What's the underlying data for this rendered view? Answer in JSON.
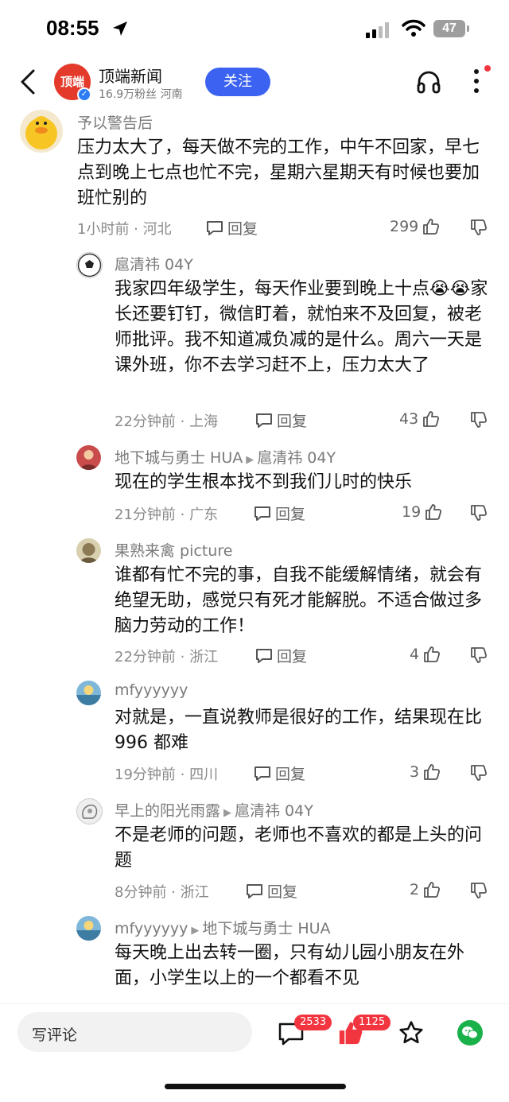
{
  "status_bar": {
    "time": "08:55",
    "battery": "47"
  },
  "header": {
    "account_name": "顶端新闻",
    "logo_text": "顶端",
    "account_meta": "16.9万粉丝 河南",
    "follow_label": "关注"
  },
  "comments": [
    {
      "user": "予以警告后",
      "text": "压力太大了，每天做不完的工作，中午不回家，早七点到晚上七点也忙不完，星期六星期天有时候也要加班忙别的",
      "meta": "1小时前 · 河北",
      "reply_label": "回复",
      "likes": "299"
    },
    {
      "user": "扈清祎 04Y",
      "text": "我家四年级学生，每天作业要到晚上十点😭😭家长还要钉钉，微信盯着，就怕来不及回复，被老师批评。我不知道减负减的是什么。周六一天是课外班，你不去学习赶不上，压力太大了",
      "meta": "22分钟前 · 上海",
      "reply_label": "回复",
      "likes": "43"
    },
    {
      "user": "地下城与勇士 HUA",
      "reply_to": "扈清祎 04Y",
      "text": "现在的学生根本找不到我们儿时的快乐",
      "meta": "21分钟前 · 广东",
      "reply_label": "回复",
      "likes": "19"
    },
    {
      "user": "果熟来禽 picture",
      "text": "谁都有忙不完的事，自我不能缓解情绪，就会有绝望无助，感觉只有死才能解脱。不适合做过多脑力劳动的工作！",
      "meta": "22分钟前 · 浙江",
      "reply_label": "回复",
      "likes": "4"
    },
    {
      "user": "mfyyyyyy",
      "text": "对就是，一直说教师是很好的工作，结果现在比 996 都难",
      "meta": "19分钟前 · 四川",
      "reply_label": "回复",
      "likes": "3"
    },
    {
      "user": "早上的阳光雨露",
      "reply_to": "扈清祎 04Y",
      "text": "不是老师的问题，老师也不喜欢的都是上头的问题",
      "meta": "8分钟前 · 浙江",
      "reply_label": "回复",
      "likes": "2"
    },
    {
      "user": "mfyyyyyy",
      "reply_to": "地下城与勇士 HUA",
      "text": "每天晚上出去转一圈，只有幼儿园小朋友在外面，小学生以上的一个都看不见",
      "meta": "",
      "reply_label": "",
      "likes": ""
    }
  ],
  "bottom_bar": {
    "comment_placeholder": "写评论",
    "comment_count": "2533",
    "like_count": "1125"
  },
  "icons": {
    "back": "chevron-left-icon",
    "headphone": "headphone-icon",
    "more": "more-vertical-icon",
    "reply": "speech-bubble-icon",
    "like": "thumbs-up-icon",
    "dislike": "thumbs-down-icon",
    "star": "star-icon",
    "wechat": "wechat-icon"
  },
  "colors": {
    "follow": "#3b62f0",
    "badge": "#f2353f",
    "logo": "#e33a2b",
    "wechat": "#1ab04a"
  }
}
